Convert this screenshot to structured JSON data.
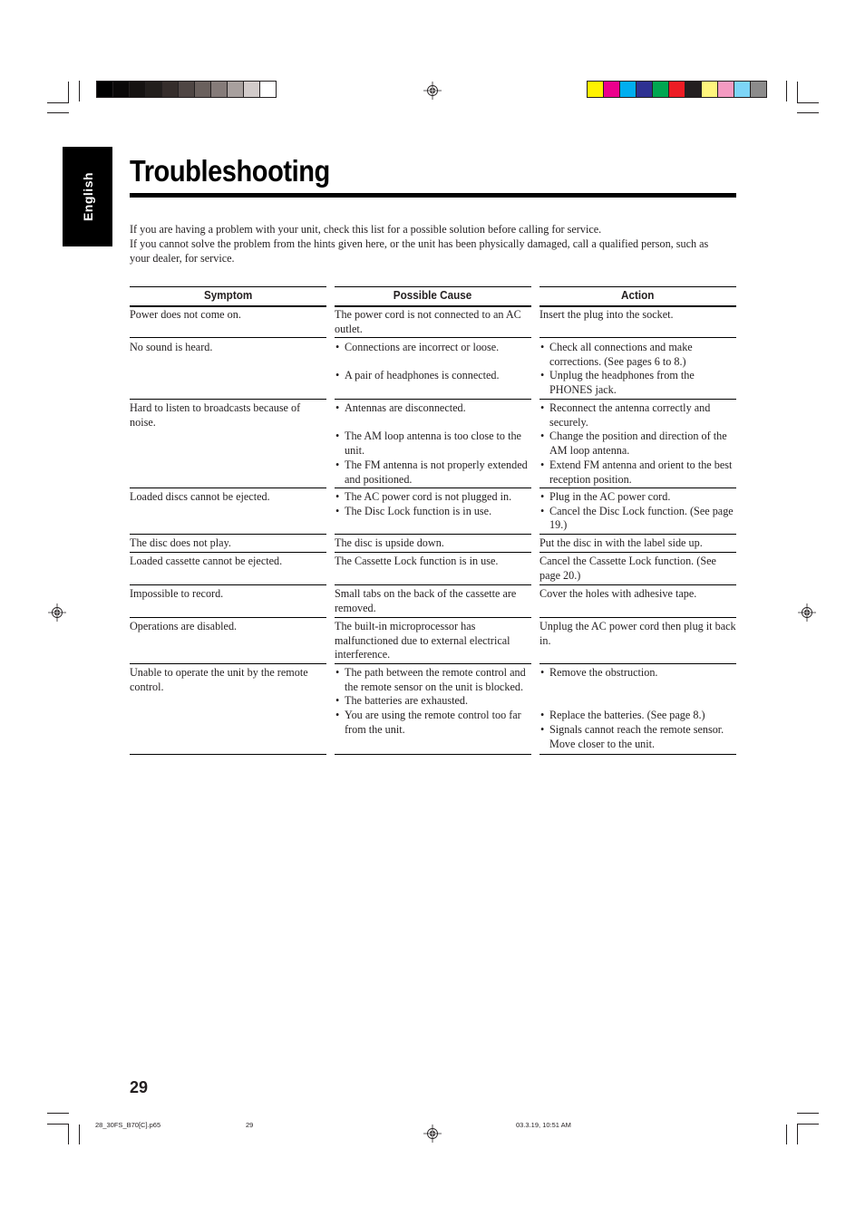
{
  "language_tab": "English",
  "title": "Troubleshooting",
  "intro": [
    "If you are having a problem with your unit, check this list for a possible solution before calling for service.",
    "If you cannot solve the problem from the hints given here, or the unit has been physically damaged, call a qualified person, such as your dealer, for service."
  ],
  "table": {
    "headers": {
      "symptom": "Symptom",
      "cause": "Possible Cause",
      "action": "Action"
    },
    "rows": [
      {
        "symptom": "Power does not come on.",
        "cause": [
          "The power cord is not connected to an AC outlet."
        ],
        "action": [
          "Insert the plug into the socket."
        ],
        "bulleted": false
      },
      {
        "symptom": "No sound is heard.",
        "cause": [
          "Connections are incorrect or loose.",
          "A pair of headphones is connected."
        ],
        "action": [
          "Check all connections and make corrections. (See pages 6 to 8.)",
          "Unplug the headphones from the PHONES jack."
        ],
        "bulleted": true
      },
      {
        "symptom": "Hard to listen to broadcasts because of noise.",
        "cause": [
          "Antennas are disconnected.",
          "The AM loop antenna is too close to the unit.",
          "The FM antenna is not properly extended and positioned."
        ],
        "action": [
          "Reconnect the antenna correctly and securely.",
          "Change the position and direction of the AM loop antenna.",
          "Extend FM antenna and orient to the best reception position."
        ],
        "bulleted": true
      },
      {
        "symptom": "Loaded discs cannot be ejected.",
        "cause": [
          "The AC power cord is not plugged in.",
          "The Disc Lock function is in use."
        ],
        "action": [
          "Plug in the AC power cord.",
          "Cancel the Disc Lock function. (See page 19.)"
        ],
        "bulleted": true
      },
      {
        "symptom": "The disc does not play.",
        "cause": [
          "The disc is upside down."
        ],
        "action": [
          "Put the disc in with the label side up."
        ],
        "bulleted": false
      },
      {
        "symptom": "Loaded cassette cannot be ejected.",
        "cause": [
          "The Cassette Lock function is in use."
        ],
        "action": [
          "Cancel the Cassette Lock function. (See page 20.)"
        ],
        "bulleted": false
      },
      {
        "symptom": "Impossible to record.",
        "cause": [
          "Small tabs on the back of the cassette are removed."
        ],
        "action": [
          "Cover the holes with adhesive tape."
        ],
        "bulleted": false
      },
      {
        "symptom": "Operations are disabled.",
        "cause": [
          "The built-in microprocessor has malfunctioned due to external electrical interference."
        ],
        "action": [
          "Unplug the AC power cord then plug it back in."
        ],
        "bulleted": false
      },
      {
        "symptom": "Unable to operate the unit by the remote control.",
        "cause": [
          "The path between the remote control and the remote sensor on the unit is blocked.",
          "The batteries are exhausted.",
          "You are using the remote control too far from the unit."
        ],
        "action": [
          "Remove the obstruction.",
          "Replace the batteries. (See page 8.)",
          "Signals cannot reach the remote sensor. Move closer to the unit."
        ],
        "bulleted": true
      }
    ]
  },
  "page_number": "29",
  "slug": {
    "filename": "28_30FS_B70[C].p65",
    "page": "29",
    "timestamp": "03.3.19, 10:51 AM"
  },
  "colorbars": {
    "grayscale": [
      "#000000",
      "#0a0808",
      "#151211",
      "#221e1c",
      "#352d2b",
      "#4f4644",
      "#6a605d",
      "#857b79",
      "#a8a09e",
      "#d2cbca",
      "#ffffff"
    ],
    "process": [
      "#fff200",
      "#ec008c",
      "#00aeef",
      "#2e3192",
      "#00a651",
      "#ed1c24",
      "#231f20",
      "#fff57d",
      "#f49ac1",
      "#7dd5f7",
      "#8c8b8b"
    ]
  }
}
